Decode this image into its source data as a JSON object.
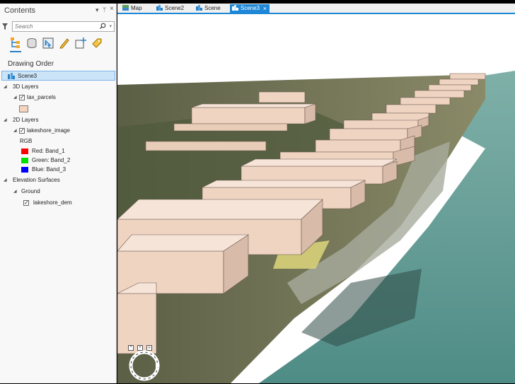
{
  "contents_pane": {
    "title": "Contents",
    "controls": {
      "dropdown": "▾",
      "pin": "ᛘ",
      "close": "×"
    },
    "search_placeholder": "Search",
    "drawing_order_label": "Drawing Order",
    "map_name": "Scene3",
    "groups": {
      "layers_3d": "3D Layers",
      "tax_parcels": "tax_parcels",
      "layers_2d": "2D Layers",
      "lakeshore_image": "lakeshore_image",
      "rgb_label": "RGB",
      "bands": [
        {
          "label": "Red:  Band_1",
          "color": "#ff0000"
        },
        {
          "label": "Green: Band_2",
          "color": "#00e000"
        },
        {
          "label": "Blue:  Band_3",
          "color": "#0000ff"
        }
      ],
      "elevation_surfaces": "Elevation Surfaces",
      "ground": "Ground",
      "lakeshore_dem": "lakeshore_dem"
    },
    "parcel_symbol_color": "#f2d6c2"
  },
  "tabs": [
    {
      "label": "Map",
      "icon": "map-icon",
      "active": false
    },
    {
      "label": "Scene2",
      "icon": "scene-icon",
      "active": false
    },
    {
      "label": "Scene",
      "icon": "scene-icon",
      "active": false
    },
    {
      "label": "Scene3",
      "icon": "scene-icon",
      "active": true,
      "close": "×"
    }
  ],
  "colors": {
    "accent": "#1e87d6",
    "selection": "#cce4f7",
    "building": "#f0d4c2",
    "water": "#5f9c95",
    "sky": "#ffffff"
  }
}
